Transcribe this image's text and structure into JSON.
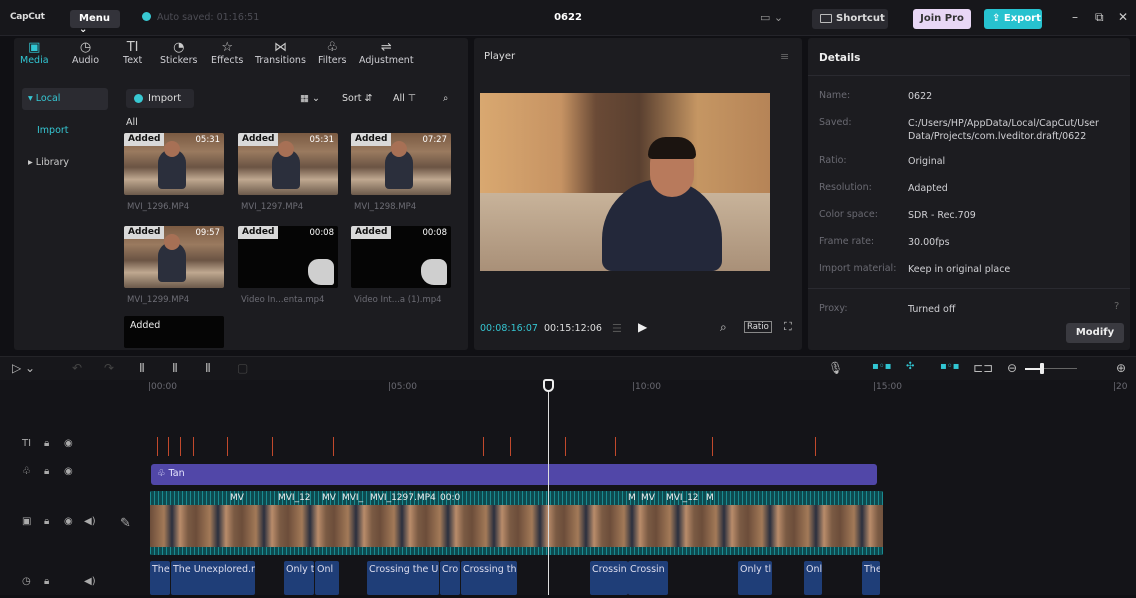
{
  "topbar": {
    "brand": "CapCut",
    "menu": "Menu",
    "autosave": "Auto saved: 01:16:51",
    "title": "0622",
    "shortcut": "Shortcut",
    "join_pro": "Join Pro",
    "export": "Export"
  },
  "toolbar": [
    {
      "label": "Media",
      "icon": "media-icon",
      "glyph": "▣"
    },
    {
      "label": "Audio",
      "icon": "audio-icon",
      "glyph": "◷"
    },
    {
      "label": "Text",
      "icon": "text-icon",
      "glyph": "TI"
    },
    {
      "label": "Stickers",
      "icon": "sticker-icon",
      "glyph": "◔"
    },
    {
      "label": "Effects",
      "icon": "effects-icon",
      "glyph": "☆"
    },
    {
      "label": "Transitions",
      "icon": "transitions-icon",
      "glyph": "⋈"
    },
    {
      "label": "Filters",
      "icon": "filters-icon",
      "glyph": "♧"
    },
    {
      "label": "Adjustment",
      "icon": "adjustment-icon",
      "glyph": "⇌"
    }
  ],
  "sidebar": {
    "local": "Local",
    "import": "Import",
    "library": "Library"
  },
  "media": {
    "import_btn": "Import",
    "sort": "Sort",
    "filter_all": "All",
    "section_all": "All",
    "items": [
      {
        "added": "Added",
        "duration": "05:31",
        "name": "MVI_1296.MP4"
      },
      {
        "added": "Added",
        "duration": "05:31",
        "name": "MVI_1297.MP4"
      },
      {
        "added": "Added",
        "duration": "07:27",
        "name": "MVI_1298.MP4"
      },
      {
        "added": "Added",
        "duration": "09:57",
        "name": "MVI_1299.MP4"
      },
      {
        "added": "Added",
        "duration": "00:08",
        "name": "Video In...enta.mp4"
      },
      {
        "added": "Added",
        "duration": "00:08",
        "name": "Video Int...a (1).mp4"
      },
      {
        "added": "Added",
        "duration": "",
        "name": ""
      }
    ]
  },
  "player": {
    "header": "Player",
    "current_time": "00:08:16:07",
    "total_time": "00:15:12:06",
    "ratio": "Ratio"
  },
  "details": {
    "header": "Details",
    "rows": [
      {
        "label": "Name:",
        "value": "0622"
      },
      {
        "label": "Saved:",
        "value": "C:/Users/HP/AppData/Local/CapCut/User Data/Projects/com.lveditor.draft/0622"
      },
      {
        "label": "Ratio:",
        "value": "Original"
      },
      {
        "label": "Resolution:",
        "value": "Adapted"
      },
      {
        "label": "Color space:",
        "value": "SDR - Rec.709"
      },
      {
        "label": "Frame rate:",
        "value": "30.00fps"
      },
      {
        "label": "Import material:",
        "value": "Keep in original place"
      },
      {
        "label": "Proxy:",
        "value": "Turned off"
      }
    ],
    "modify": "Modify"
  },
  "timeline": {
    "ruler": [
      "|00:00",
      "|05:00",
      "|10:00",
      "|15:00",
      "|20"
    ],
    "audio_clip": "Tan",
    "video_labels": [
      "MV",
      "MVI_12",
      "MV",
      "MVI_",
      "MVI_1297.MP4",
      "00:0",
      "M",
      "MV",
      "MVI_12",
      "M"
    ],
    "subtitles": [
      "The",
      "The Unexplored.mp",
      "Only t",
      "Onl",
      "Crossing the Un",
      "Cro",
      "Crossing the",
      "Crossin",
      "Crossin",
      "Only tl",
      "Onl",
      "The"
    ]
  },
  "colors": {
    "accent": "#31c6d3",
    "audio_track": "#5147a8",
    "video_track": "#0e5a5f",
    "subtitle_track": "#1f3e78",
    "text_marker": "#c2492c"
  }
}
